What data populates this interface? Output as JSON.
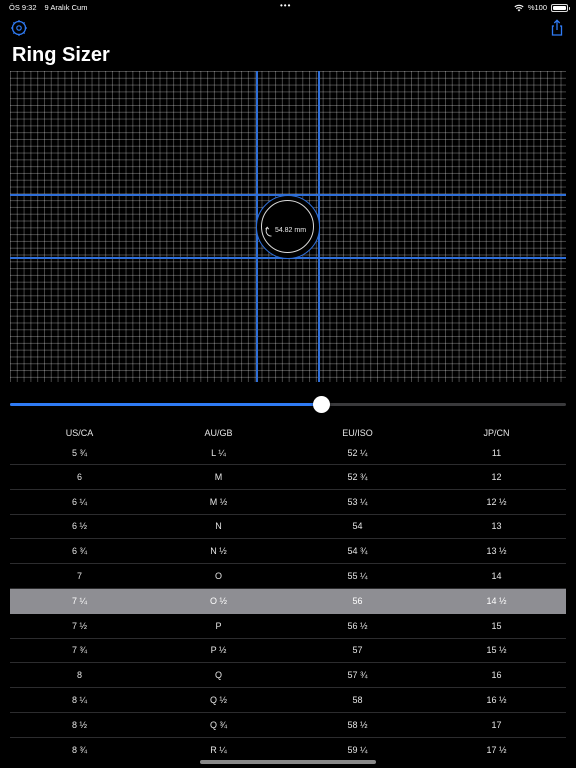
{
  "status_bar": {
    "time": "ÖS 9:32",
    "date": "9 Aralık Cum",
    "dots": "•••",
    "battery": "%100"
  },
  "page_title": "Ring Sizer",
  "icons": {
    "settings": "gear-icon",
    "share": "share-icon",
    "rotate": "rotate-icon"
  },
  "ring": {
    "diameter_label": "54.82 mm"
  },
  "slider": {
    "value_fraction": 0.56
  },
  "colors": {
    "accent": "#2f7bf5",
    "guide": "#2f6fd8",
    "selected_row": "#8e8e93"
  },
  "table": {
    "headers": [
      "US/CA",
      "AU/GB",
      "EU/ISO",
      "JP/CN"
    ],
    "selected_index": 6,
    "rows": [
      [
        "5 ¾",
        "L ¼",
        "52 ¼",
        "11"
      ],
      [
        "6",
        "M",
        "52 ¾",
        "12"
      ],
      [
        "6 ¼",
        "M ½",
        "53 ¼",
        "12 ½"
      ],
      [
        "6 ½",
        "N",
        "54",
        "13"
      ],
      [
        "6 ¾",
        "N ½",
        "54 ¾",
        "13 ½"
      ],
      [
        "7",
        "O",
        "55 ¼",
        "14"
      ],
      [
        "7 ¼",
        "O ½",
        "56",
        "14 ½"
      ],
      [
        "7 ½",
        "P",
        "56 ½",
        "15"
      ],
      [
        "7 ¾",
        "P ½",
        "57",
        "15 ½"
      ],
      [
        "8",
        "Q",
        "57 ¾",
        "16"
      ],
      [
        "8 ¼",
        "Q ½",
        "58",
        "16 ½"
      ],
      [
        "8 ½",
        "Q ¾",
        "58 ½",
        "17"
      ],
      [
        "8 ¾",
        "R ¼",
        "59 ¼",
        "17 ½"
      ]
    ]
  }
}
